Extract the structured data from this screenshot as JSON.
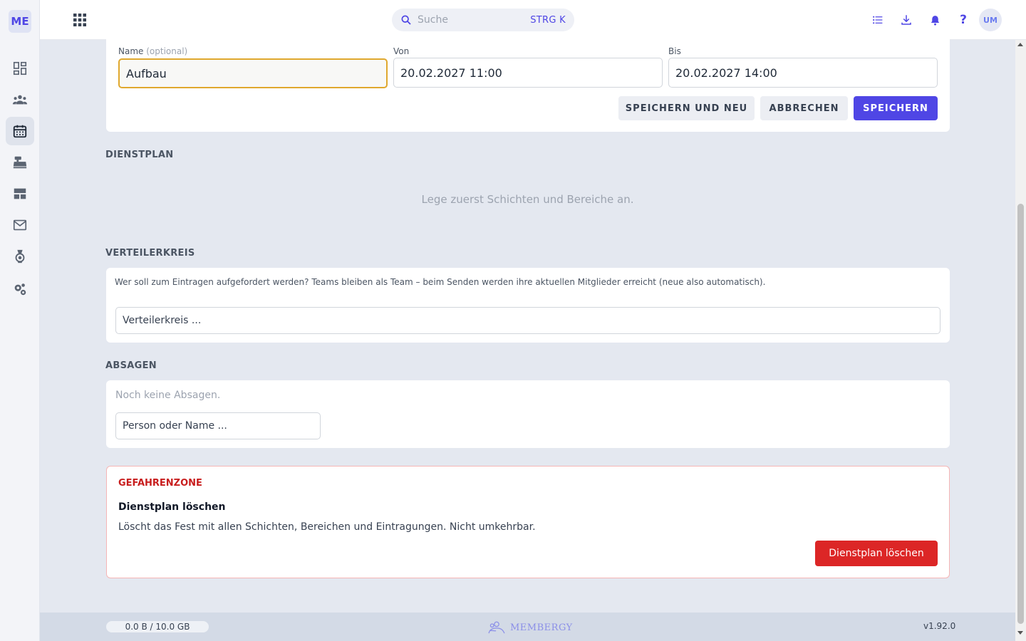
{
  "app": {
    "logo": "ME"
  },
  "search": {
    "placeholder": "Suche",
    "shortcut": "STRG K"
  },
  "user": {
    "initials": "UM"
  },
  "form": {
    "name_label": "Name",
    "name_optional": "(optional)",
    "name_value": "Aufbau",
    "from_label": "Von",
    "from_value": "20.02.2027 11:00",
    "to_label": "Bis",
    "to_value": "20.02.2027 14:00",
    "save_new_label": "SPEICHERN UND NEU",
    "cancel_label": "ABBRECHEN",
    "save_label": "SPEICHERN"
  },
  "dienstplan": {
    "title": "DIENSTPLAN",
    "empty": "Lege zuerst Schichten und Bereiche an."
  },
  "verteiler": {
    "title": "VERTEILERKREIS",
    "hint": "Wer soll zum Eintragen aufgefordert werden? Teams bleiben als Team – beim Senden werden ihre aktuellen Mitglieder erreicht (neue also automatisch).",
    "placeholder": "Verteilerkreis ..."
  },
  "absagen": {
    "title": "ABSAGEN",
    "empty": "Noch keine Absagen.",
    "placeholder": "Person oder Name ..."
  },
  "danger": {
    "title": "GEFAHRENZONE",
    "heading": "Dienstplan löschen",
    "description": "Löscht das Fest mit allen Schichten, Bereichen und Eintragungen. Nicht umkehrbar.",
    "button": "Dienstplan löschen"
  },
  "footer": {
    "storage": "0.0 B / 10.0 GB",
    "brand": "MEMBERGY",
    "version": "v1.92.0"
  },
  "colors": {
    "accent": "#4f46e5",
    "danger": "#dc2626",
    "focus": "#e0a82e"
  }
}
